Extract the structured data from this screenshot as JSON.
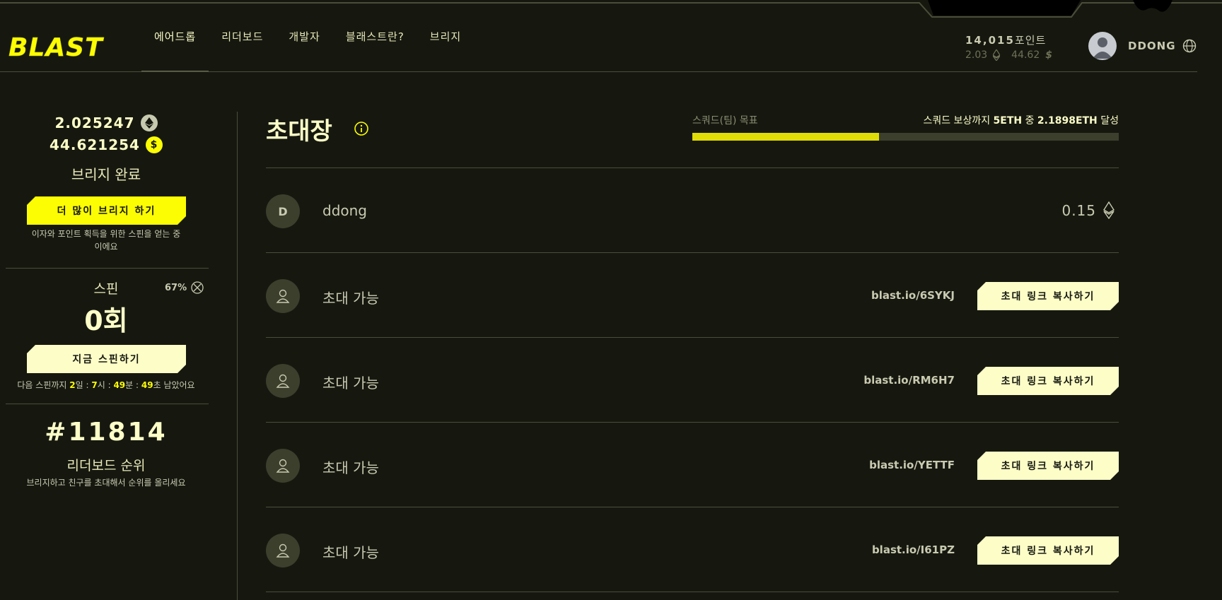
{
  "header": {
    "logo_text": "BLAST",
    "nav": [
      {
        "label": "에어드롭",
        "active": true
      },
      {
        "label": "리더보드",
        "active": false
      },
      {
        "label": "개발자",
        "active": false
      },
      {
        "label": "블래스트란?",
        "active": false
      },
      {
        "label": "브리지",
        "active": false
      }
    ],
    "points_value": "14,015",
    "points_unit": "포인트",
    "eth_balance": "2.03",
    "usd_balance": "44.62",
    "username": "DDONG"
  },
  "sidebar": {
    "eth_amount": "2.025247",
    "usd_amount": "44.621254",
    "bridge_status": "브리지 완료",
    "bridge_more_button": "더 많이 브리지 하기",
    "bridge_note": "이자와 포인트 획득을 위한 스핀을 얻는 중이에요",
    "spin_label": "스핀",
    "spin_percent": "67%",
    "spin_count": "0회",
    "spin_now_button": "지금 스핀하기",
    "spin_next_prefix": "다음 스핀까지",
    "spin_days": "2",
    "spin_days_unit": "일",
    "spin_hours": "7",
    "spin_hours_unit": "시",
    "spin_minutes": "49",
    "spin_minutes_unit": "분",
    "spin_seconds": "49",
    "spin_seconds_unit": "초",
    "spin_next_suffix": "남았어요",
    "rank": "#11814",
    "rank_label": "리더보드 순위",
    "rank_note": "브리지하고 친구를 초대해서 순위를 올리세요"
  },
  "main": {
    "title": "초대장",
    "goal_label": "스쿼드(팀) 목표",
    "goal_prefix": "스쿼드 보상까지",
    "goal_target": "5ETH",
    "goal_mid": "중",
    "goal_current": "2.1898ETH",
    "goal_suffix": "달성",
    "goal_progress": 0.438,
    "members": [
      {
        "initial": "D",
        "name": "ddong",
        "value": "0.15"
      }
    ],
    "invites": [
      {
        "status": "초대 가능",
        "link": "blast.io/6SYKJ",
        "button": "초대 링크 복사하기"
      },
      {
        "status": "초대 가능",
        "link": "blast.io/RM6H7",
        "button": "초대 링크 복사하기"
      },
      {
        "status": "초대 가능",
        "link": "blast.io/YETTF",
        "button": "초대 링크 복사하기"
      },
      {
        "status": "초대 가능",
        "link": "blast.io/I61PZ",
        "button": "초대 링크 복사하기"
      }
    ]
  },
  "colors": {
    "background": "#161810",
    "accent_yellow": "#fcfc03",
    "cream": "#fcfdc7",
    "muted": "#c9cab0",
    "line": "#4a4d38"
  },
  "icons": [
    "eth-icon",
    "usd-coin-icon",
    "info-icon",
    "user-icon",
    "globe-icon",
    "clover-icon"
  ]
}
